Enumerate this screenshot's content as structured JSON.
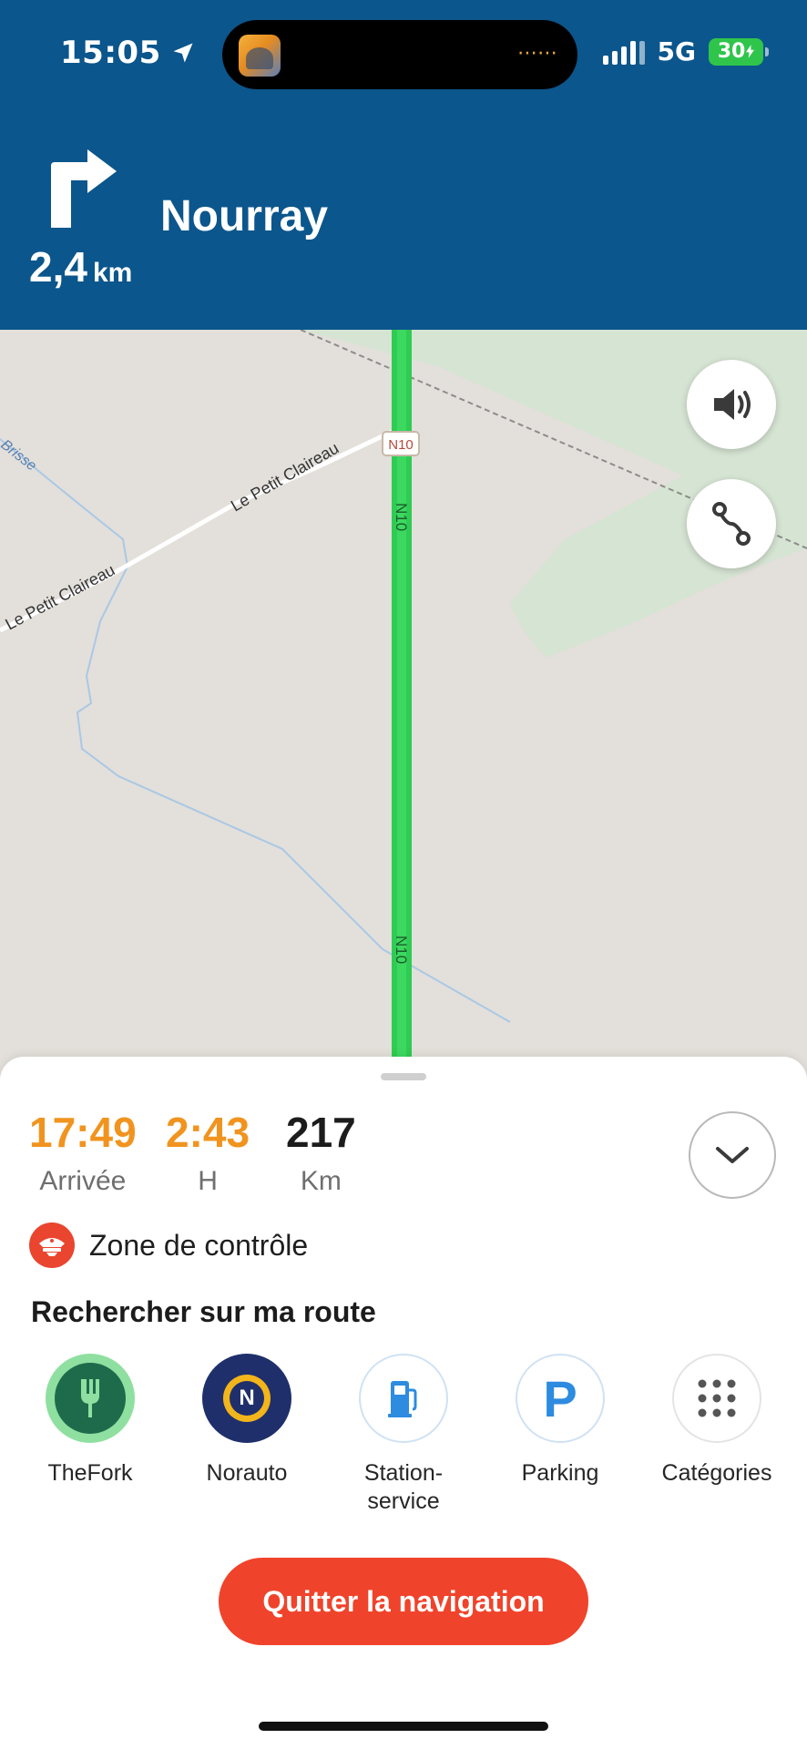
{
  "status_bar": {
    "time": "15:05",
    "network": "5G",
    "battery": "30",
    "location_icon": "location-arrow-icon",
    "signal_icon": "signal-bars-icon",
    "battery_icon": "battery-charging-icon",
    "live_activity_icon": "app-thumbnail-icon",
    "live_activity_dots": "⋯⋯"
  },
  "instruction": {
    "turn_icon": "turn-right-arrow-icon",
    "distance_value": "2,4",
    "distance_unit": "km",
    "destination": "Nourray"
  },
  "map": {
    "road_labels": [
      "N10",
      "N10",
      "N10",
      "Le Petit Claireau",
      "Le Petit Claireau",
      "Brisse"
    ],
    "buttons": {
      "sound_icon": "speaker-icon",
      "route_icon": "route-overview-icon"
    },
    "route_color": "#2ecc52"
  },
  "trip": {
    "arrival_time": "17:49",
    "arrival_label": "Arrivée",
    "duration": "2:43",
    "duration_label": "H",
    "distance": "217",
    "distance_label": "Km",
    "collapse_icon": "chevron-down-icon"
  },
  "alert": {
    "icon": "police-cap-icon",
    "text": "Zone de contrôle"
  },
  "search": {
    "title": "Rechercher sur ma route",
    "categories": [
      {
        "label": "TheFork",
        "icon": "thefork-logo-icon"
      },
      {
        "label": "Norauto",
        "icon": "norauto-logo-icon"
      },
      {
        "label": "Station-\nservice",
        "icon": "fuel-pump-icon"
      },
      {
        "label": "Parking",
        "icon": "parking-icon"
      },
      {
        "label": "Catégories",
        "icon": "grid-dots-icon"
      }
    ]
  },
  "quit_button": "Quitter la navigation",
  "colors": {
    "header_blue": "#0b568c",
    "accent_orange": "#f0941f",
    "quit_red": "#f0432b"
  }
}
